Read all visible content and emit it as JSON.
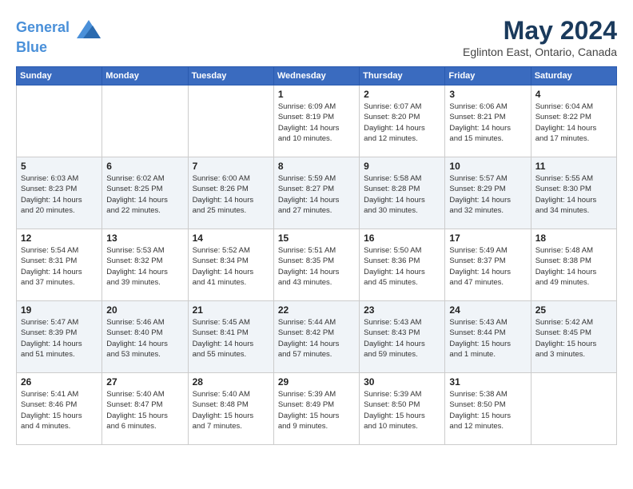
{
  "header": {
    "logo_line1": "General",
    "logo_line2": "Blue",
    "month_year": "May 2024",
    "location": "Eglinton East, Ontario, Canada"
  },
  "days_of_week": [
    "Sunday",
    "Monday",
    "Tuesday",
    "Wednesday",
    "Thursday",
    "Friday",
    "Saturday"
  ],
  "weeks": [
    [
      {
        "day": "",
        "info": ""
      },
      {
        "day": "",
        "info": ""
      },
      {
        "day": "",
        "info": ""
      },
      {
        "day": "1",
        "info": "Sunrise: 6:09 AM\nSunset: 8:19 PM\nDaylight: 14 hours\nand 10 minutes."
      },
      {
        "day": "2",
        "info": "Sunrise: 6:07 AM\nSunset: 8:20 PM\nDaylight: 14 hours\nand 12 minutes."
      },
      {
        "day": "3",
        "info": "Sunrise: 6:06 AM\nSunset: 8:21 PM\nDaylight: 14 hours\nand 15 minutes."
      },
      {
        "day": "4",
        "info": "Sunrise: 6:04 AM\nSunset: 8:22 PM\nDaylight: 14 hours\nand 17 minutes."
      }
    ],
    [
      {
        "day": "5",
        "info": "Sunrise: 6:03 AM\nSunset: 8:23 PM\nDaylight: 14 hours\nand 20 minutes."
      },
      {
        "day": "6",
        "info": "Sunrise: 6:02 AM\nSunset: 8:25 PM\nDaylight: 14 hours\nand 22 minutes."
      },
      {
        "day": "7",
        "info": "Sunrise: 6:00 AM\nSunset: 8:26 PM\nDaylight: 14 hours\nand 25 minutes."
      },
      {
        "day": "8",
        "info": "Sunrise: 5:59 AM\nSunset: 8:27 PM\nDaylight: 14 hours\nand 27 minutes."
      },
      {
        "day": "9",
        "info": "Sunrise: 5:58 AM\nSunset: 8:28 PM\nDaylight: 14 hours\nand 30 minutes."
      },
      {
        "day": "10",
        "info": "Sunrise: 5:57 AM\nSunset: 8:29 PM\nDaylight: 14 hours\nand 32 minutes."
      },
      {
        "day": "11",
        "info": "Sunrise: 5:55 AM\nSunset: 8:30 PM\nDaylight: 14 hours\nand 34 minutes."
      }
    ],
    [
      {
        "day": "12",
        "info": "Sunrise: 5:54 AM\nSunset: 8:31 PM\nDaylight: 14 hours\nand 37 minutes."
      },
      {
        "day": "13",
        "info": "Sunrise: 5:53 AM\nSunset: 8:32 PM\nDaylight: 14 hours\nand 39 minutes."
      },
      {
        "day": "14",
        "info": "Sunrise: 5:52 AM\nSunset: 8:34 PM\nDaylight: 14 hours\nand 41 minutes."
      },
      {
        "day": "15",
        "info": "Sunrise: 5:51 AM\nSunset: 8:35 PM\nDaylight: 14 hours\nand 43 minutes."
      },
      {
        "day": "16",
        "info": "Sunrise: 5:50 AM\nSunset: 8:36 PM\nDaylight: 14 hours\nand 45 minutes."
      },
      {
        "day": "17",
        "info": "Sunrise: 5:49 AM\nSunset: 8:37 PM\nDaylight: 14 hours\nand 47 minutes."
      },
      {
        "day": "18",
        "info": "Sunrise: 5:48 AM\nSunset: 8:38 PM\nDaylight: 14 hours\nand 49 minutes."
      }
    ],
    [
      {
        "day": "19",
        "info": "Sunrise: 5:47 AM\nSunset: 8:39 PM\nDaylight: 14 hours\nand 51 minutes."
      },
      {
        "day": "20",
        "info": "Sunrise: 5:46 AM\nSunset: 8:40 PM\nDaylight: 14 hours\nand 53 minutes."
      },
      {
        "day": "21",
        "info": "Sunrise: 5:45 AM\nSunset: 8:41 PM\nDaylight: 14 hours\nand 55 minutes."
      },
      {
        "day": "22",
        "info": "Sunrise: 5:44 AM\nSunset: 8:42 PM\nDaylight: 14 hours\nand 57 minutes."
      },
      {
        "day": "23",
        "info": "Sunrise: 5:43 AM\nSunset: 8:43 PM\nDaylight: 14 hours\nand 59 minutes."
      },
      {
        "day": "24",
        "info": "Sunrise: 5:43 AM\nSunset: 8:44 PM\nDaylight: 15 hours\nand 1 minute."
      },
      {
        "day": "25",
        "info": "Sunrise: 5:42 AM\nSunset: 8:45 PM\nDaylight: 15 hours\nand 3 minutes."
      }
    ],
    [
      {
        "day": "26",
        "info": "Sunrise: 5:41 AM\nSunset: 8:46 PM\nDaylight: 15 hours\nand 4 minutes."
      },
      {
        "day": "27",
        "info": "Sunrise: 5:40 AM\nSunset: 8:47 PM\nDaylight: 15 hours\nand 6 minutes."
      },
      {
        "day": "28",
        "info": "Sunrise: 5:40 AM\nSunset: 8:48 PM\nDaylight: 15 hours\nand 7 minutes."
      },
      {
        "day": "29",
        "info": "Sunrise: 5:39 AM\nSunset: 8:49 PM\nDaylight: 15 hours\nand 9 minutes."
      },
      {
        "day": "30",
        "info": "Sunrise: 5:39 AM\nSunset: 8:50 PM\nDaylight: 15 hours\nand 10 minutes."
      },
      {
        "day": "31",
        "info": "Sunrise: 5:38 AM\nSunset: 8:50 PM\nDaylight: 15 hours\nand 12 minutes."
      },
      {
        "day": "",
        "info": ""
      }
    ]
  ]
}
